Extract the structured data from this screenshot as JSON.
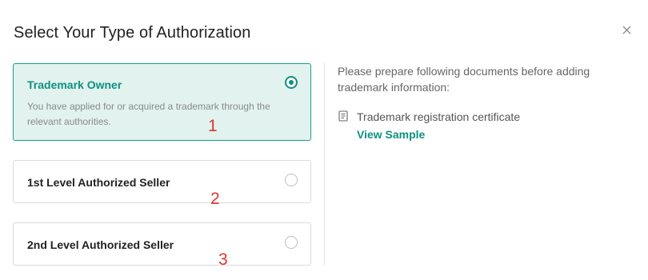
{
  "dialog": {
    "title": "Select Your Type of Authorization",
    "close_icon": "close-icon"
  },
  "options": [
    {
      "title": "Trademark Owner",
      "description": "You have applied for or acquired a trademark through the relevant authorities.",
      "selected": true,
      "annotation": "1"
    },
    {
      "title": "1st Level Authorized Seller",
      "selected": false,
      "annotation": "2"
    },
    {
      "title": "2nd Level Authorized Seller",
      "selected": false,
      "annotation": "3"
    }
  ],
  "documents": {
    "intro": "Please prepare following documents before adding trademark information:",
    "items": [
      {
        "icon": "document-icon",
        "name": "Trademark registration certificate",
        "link": "View Sample"
      }
    ]
  },
  "colors": {
    "accent": "#0f9180",
    "selected_bg": "#e1f2ef",
    "annotation": "#d9382c"
  }
}
